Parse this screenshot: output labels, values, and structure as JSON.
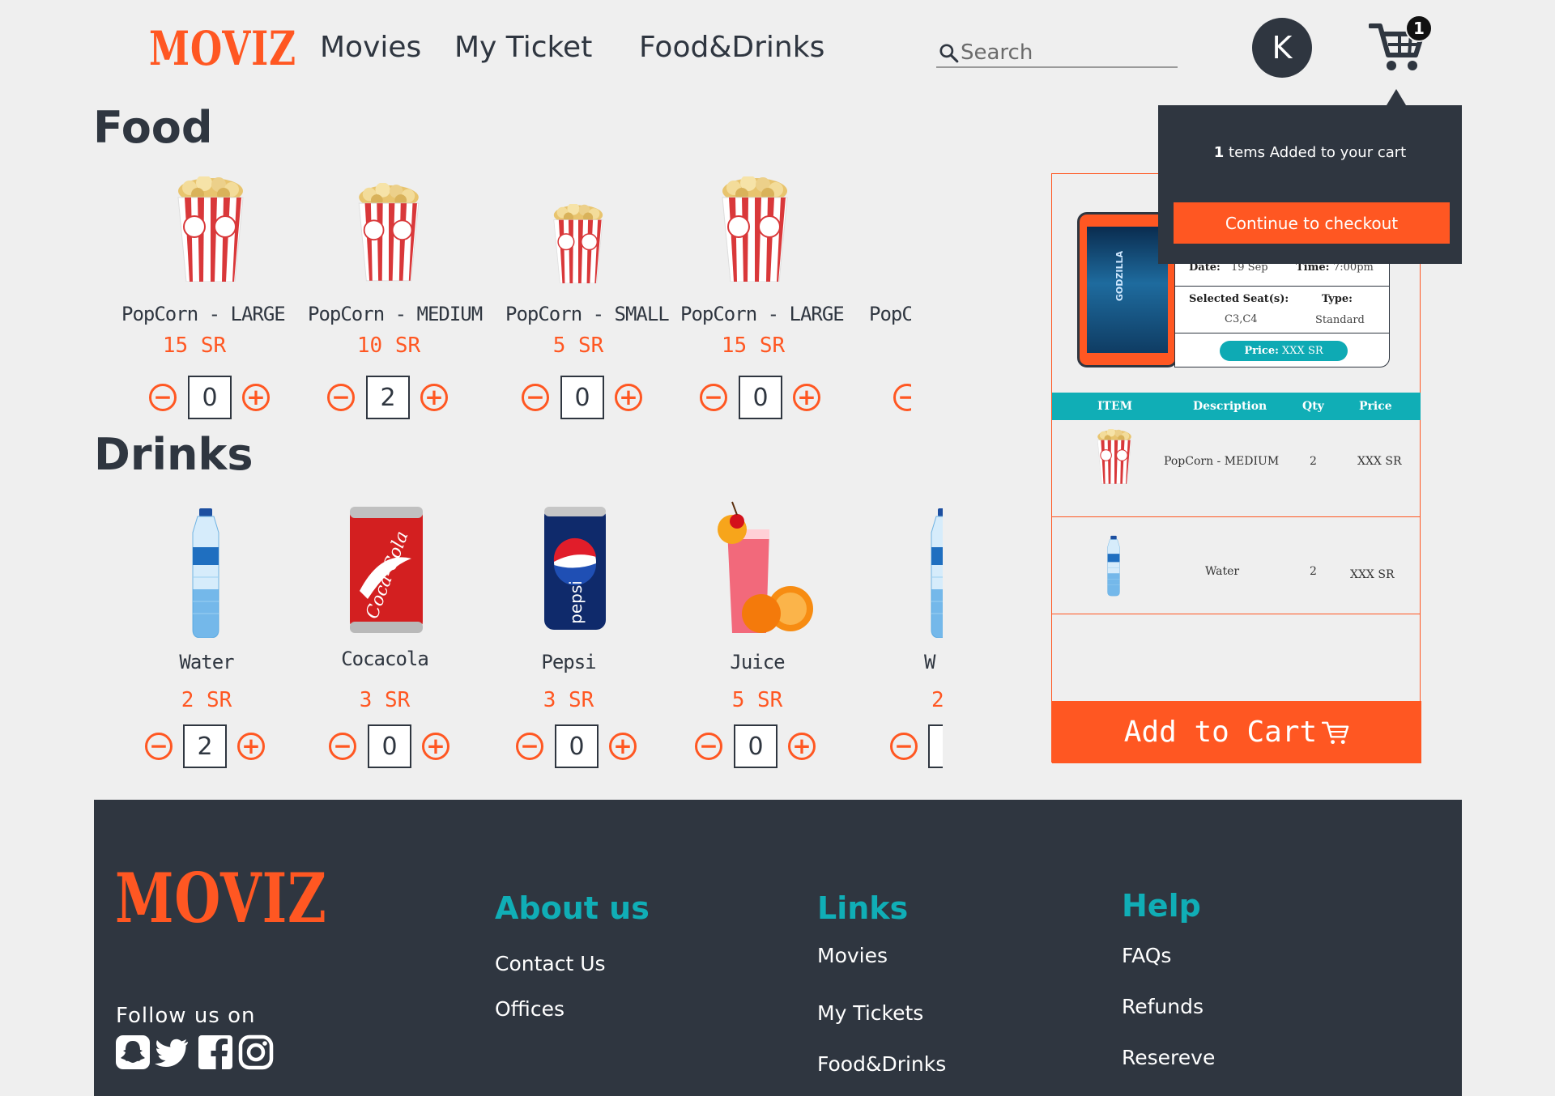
{
  "header": {
    "logo": "MOVIZ",
    "nav": [
      "Movies",
      "My Ticket",
      "Food&Drinks"
    ],
    "search_placeholder": "Search",
    "avatar_initial": "K",
    "cart_count": "1"
  },
  "food": {
    "title": "Food",
    "items": [
      {
        "name": "PopCorn - LARGE",
        "price": "15 SR",
        "qty": "0"
      },
      {
        "name": "PopCorn - MEDIUM",
        "price": "10 SR",
        "qty": "2"
      },
      {
        "name": "PopCorn - SMALL",
        "price": "5 SR",
        "qty": "0"
      },
      {
        "name": "PopCorn - LARGE",
        "price": "15 SR",
        "qty": "0"
      },
      {
        "name": "PopC"
      }
    ]
  },
  "drinks": {
    "title": "Drinks",
    "items": [
      {
        "name": "Water",
        "price": "2 SR",
        "qty": "2"
      },
      {
        "name": "Cocacola",
        "price": "3 SR",
        "qty": "0"
      },
      {
        "name": "Pepsi",
        "price": "3 SR",
        "qty": "0"
      },
      {
        "name": "Juice",
        "price": "5 SR",
        "qty": "0"
      },
      {
        "name": "W",
        "price": "2"
      }
    ]
  },
  "popup": {
    "count": "1",
    "message": "tems Added to your cart",
    "button": "Continue to checkout"
  },
  "ticket": {
    "poster_text": "GODZILLA",
    "date_label": "Date:",
    "date": "19 Sep",
    "time_label": "Time:",
    "time": "7:00pm",
    "seats_label": "Selected Seat(s):",
    "seats": "C3,C4",
    "type_label": "Type:",
    "type": "Standard",
    "price_label": "Price:",
    "price": "XXX SR"
  },
  "cart_table": {
    "headers": [
      "ITEM",
      "Description",
      "Qty",
      "Price"
    ],
    "rows": [
      {
        "description": "PopCorn - MEDIUM",
        "qty": "2",
        "price": "XXX SR"
      },
      {
        "description": "Water",
        "qty": "2",
        "price": "XXX SR"
      }
    ],
    "add_button": "Add to Cart"
  },
  "footer": {
    "logo": "MOVIZ",
    "follow": "Follow us on",
    "social": [
      "snapchat-icon",
      "twitter-icon",
      "facebook-icon",
      "instagram-icon"
    ],
    "about": {
      "title": "About us",
      "links": [
        "Contact Us",
        "Offices"
      ]
    },
    "links": {
      "title": "Links",
      "links": [
        "Movies",
        "My Tickets",
        "Food&Drinks"
      ]
    },
    "help": {
      "title": "Help",
      "links": [
        "FAQs",
        "Refunds",
        "Resereve"
      ]
    }
  },
  "colors": {
    "accent": "#ff5722",
    "dark": "#2f3640",
    "teal": "#10aeb6",
    "background": "#efefef"
  }
}
